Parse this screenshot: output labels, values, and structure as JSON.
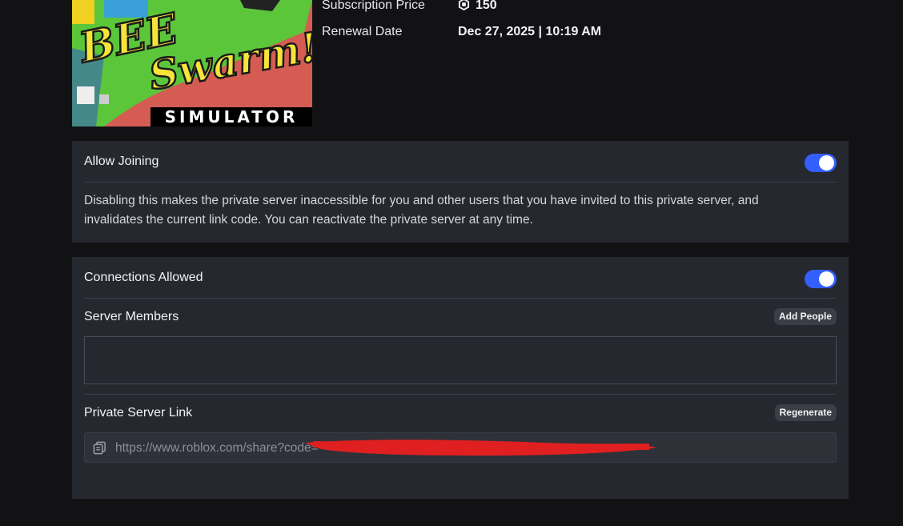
{
  "thumbnail": {
    "title_top": "BEE",
    "title_mid": "Swarm!",
    "caption": "SIMULATOR"
  },
  "details": {
    "price_label": "Subscription Price",
    "price_value": "150",
    "price_icon": "robux-icon",
    "renewal_label": "Renewal Date",
    "renewal_value": "Dec 27, 2025 | 10:19 AM"
  },
  "joining": {
    "title": "Allow Joining",
    "enabled": true,
    "description": "Disabling this makes the private server inaccessible for you and other users that you have invited to this private server, and invalidates the current link code. You can reactivate the private server at any time."
  },
  "connections": {
    "title": "Connections Allowed",
    "enabled": true
  },
  "members": {
    "title": "Server Members",
    "add_button": "Add People"
  },
  "link": {
    "title": "Private Server Link",
    "regenerate_button": "Regenerate",
    "url": "https://www.roblox.com/share?code=",
    "copy_icon": "copy-icon"
  },
  "colors": {
    "background": "#121215",
    "panel": "#262830",
    "toggle_on": "#335fff",
    "redaction": "#e02020"
  }
}
